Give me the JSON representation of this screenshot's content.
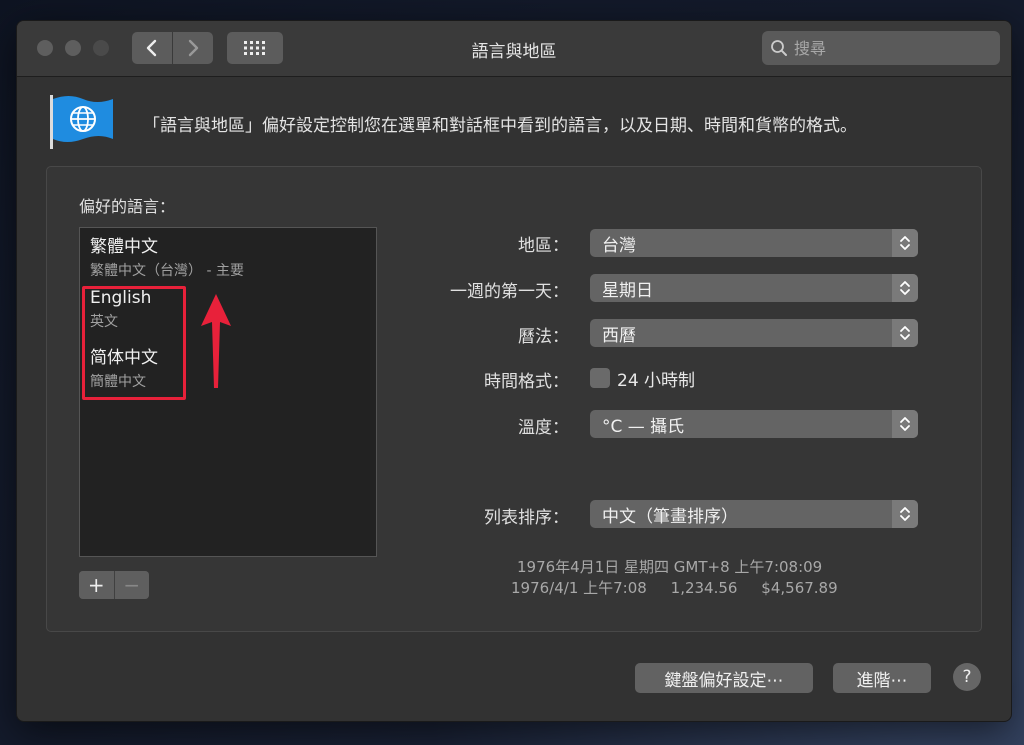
{
  "window": {
    "title": "語言與地區",
    "search_placeholder": "搜尋"
  },
  "header": {
    "icon": "globe-flag-icon",
    "description": "「語言與地區」偏好設定控制您在選單和對話框中看到的語言，以及日期、時間和貨幣的格式。"
  },
  "preferred": {
    "label": "偏好的語言：",
    "languages": [
      {
        "name": "繁體中文",
        "subtitle": "繁體中文（台灣） - 主要"
      },
      {
        "name": "English",
        "subtitle": "英文"
      },
      {
        "name": "简体中文",
        "subtitle": "簡體中文"
      }
    ],
    "add_label": "+",
    "remove_label": "−"
  },
  "settings": {
    "region_label": "地區：",
    "region_value": "台灣",
    "first_day_label": "一週的第一天：",
    "first_day_value": "星期日",
    "calendar_label": "曆法：",
    "calendar_value": "西曆",
    "time_format_label": "時間格式：",
    "time_format_checkbox": "24 小時制",
    "time_format_checked": false,
    "temperature_label": "溫度：",
    "temperature_value": "°C — 攝氏",
    "sort_label": "列表排序：",
    "sort_value": "中文（筆畫排序）"
  },
  "sample": {
    "line1": "1976年4月1日 星期四 GMT+8 上午7:08:09",
    "line2": "1976/4/1 上午7:08     1,234.56     $4,567.89"
  },
  "footer": {
    "keyboard_label": "鍵盤偏好設定⋯",
    "advanced_label": "進階⋯",
    "help_label": "?"
  },
  "colors": {
    "annotation": "#e8213a",
    "flag_blue": "#1f8ce0"
  }
}
